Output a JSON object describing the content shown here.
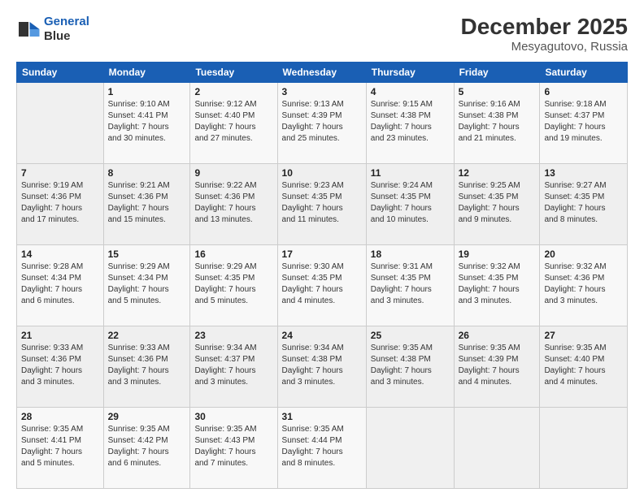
{
  "header": {
    "logo_line1": "General",
    "logo_line2": "Blue",
    "title": "December 2025",
    "subtitle": "Mesyagutovo, Russia"
  },
  "days_of_week": [
    "Sunday",
    "Monday",
    "Tuesday",
    "Wednesday",
    "Thursday",
    "Friday",
    "Saturday"
  ],
  "weeks": [
    [
      {
        "day": "",
        "info": ""
      },
      {
        "day": "1",
        "info": "Sunrise: 9:10 AM\nSunset: 4:41 PM\nDaylight: 7 hours\nand 30 minutes."
      },
      {
        "day": "2",
        "info": "Sunrise: 9:12 AM\nSunset: 4:40 PM\nDaylight: 7 hours\nand 27 minutes."
      },
      {
        "day": "3",
        "info": "Sunrise: 9:13 AM\nSunset: 4:39 PM\nDaylight: 7 hours\nand 25 minutes."
      },
      {
        "day": "4",
        "info": "Sunrise: 9:15 AM\nSunset: 4:38 PM\nDaylight: 7 hours\nand 23 minutes."
      },
      {
        "day": "5",
        "info": "Sunrise: 9:16 AM\nSunset: 4:38 PM\nDaylight: 7 hours\nand 21 minutes."
      },
      {
        "day": "6",
        "info": "Sunrise: 9:18 AM\nSunset: 4:37 PM\nDaylight: 7 hours\nand 19 minutes."
      }
    ],
    [
      {
        "day": "7",
        "info": "Sunrise: 9:19 AM\nSunset: 4:36 PM\nDaylight: 7 hours\nand 17 minutes."
      },
      {
        "day": "8",
        "info": "Sunrise: 9:21 AM\nSunset: 4:36 PM\nDaylight: 7 hours\nand 15 minutes."
      },
      {
        "day": "9",
        "info": "Sunrise: 9:22 AM\nSunset: 4:36 PM\nDaylight: 7 hours\nand 13 minutes."
      },
      {
        "day": "10",
        "info": "Sunrise: 9:23 AM\nSunset: 4:35 PM\nDaylight: 7 hours\nand 11 minutes."
      },
      {
        "day": "11",
        "info": "Sunrise: 9:24 AM\nSunset: 4:35 PM\nDaylight: 7 hours\nand 10 minutes."
      },
      {
        "day": "12",
        "info": "Sunrise: 9:25 AM\nSunset: 4:35 PM\nDaylight: 7 hours\nand 9 minutes."
      },
      {
        "day": "13",
        "info": "Sunrise: 9:27 AM\nSunset: 4:35 PM\nDaylight: 7 hours\nand 8 minutes."
      }
    ],
    [
      {
        "day": "14",
        "info": "Sunrise: 9:28 AM\nSunset: 4:34 PM\nDaylight: 7 hours\nand 6 minutes."
      },
      {
        "day": "15",
        "info": "Sunrise: 9:29 AM\nSunset: 4:34 PM\nDaylight: 7 hours\nand 5 minutes."
      },
      {
        "day": "16",
        "info": "Sunrise: 9:29 AM\nSunset: 4:35 PM\nDaylight: 7 hours\nand 5 minutes."
      },
      {
        "day": "17",
        "info": "Sunrise: 9:30 AM\nSunset: 4:35 PM\nDaylight: 7 hours\nand 4 minutes."
      },
      {
        "day": "18",
        "info": "Sunrise: 9:31 AM\nSunset: 4:35 PM\nDaylight: 7 hours\nand 3 minutes."
      },
      {
        "day": "19",
        "info": "Sunrise: 9:32 AM\nSunset: 4:35 PM\nDaylight: 7 hours\nand 3 minutes."
      },
      {
        "day": "20",
        "info": "Sunrise: 9:32 AM\nSunset: 4:36 PM\nDaylight: 7 hours\nand 3 minutes."
      }
    ],
    [
      {
        "day": "21",
        "info": "Sunrise: 9:33 AM\nSunset: 4:36 PM\nDaylight: 7 hours\nand 3 minutes."
      },
      {
        "day": "22",
        "info": "Sunrise: 9:33 AM\nSunset: 4:36 PM\nDaylight: 7 hours\nand 3 minutes."
      },
      {
        "day": "23",
        "info": "Sunrise: 9:34 AM\nSunset: 4:37 PM\nDaylight: 7 hours\nand 3 minutes."
      },
      {
        "day": "24",
        "info": "Sunrise: 9:34 AM\nSunset: 4:38 PM\nDaylight: 7 hours\nand 3 minutes."
      },
      {
        "day": "25",
        "info": "Sunrise: 9:35 AM\nSunset: 4:38 PM\nDaylight: 7 hours\nand 3 minutes."
      },
      {
        "day": "26",
        "info": "Sunrise: 9:35 AM\nSunset: 4:39 PM\nDaylight: 7 hours\nand 4 minutes."
      },
      {
        "day": "27",
        "info": "Sunrise: 9:35 AM\nSunset: 4:40 PM\nDaylight: 7 hours\nand 4 minutes."
      }
    ],
    [
      {
        "day": "28",
        "info": "Sunrise: 9:35 AM\nSunset: 4:41 PM\nDaylight: 7 hours\nand 5 minutes."
      },
      {
        "day": "29",
        "info": "Sunrise: 9:35 AM\nSunset: 4:42 PM\nDaylight: 7 hours\nand 6 minutes."
      },
      {
        "day": "30",
        "info": "Sunrise: 9:35 AM\nSunset: 4:43 PM\nDaylight: 7 hours\nand 7 minutes."
      },
      {
        "day": "31",
        "info": "Sunrise: 9:35 AM\nSunset: 4:44 PM\nDaylight: 7 hours\nand 8 minutes."
      },
      {
        "day": "",
        "info": ""
      },
      {
        "day": "",
        "info": ""
      },
      {
        "day": "",
        "info": ""
      }
    ]
  ]
}
